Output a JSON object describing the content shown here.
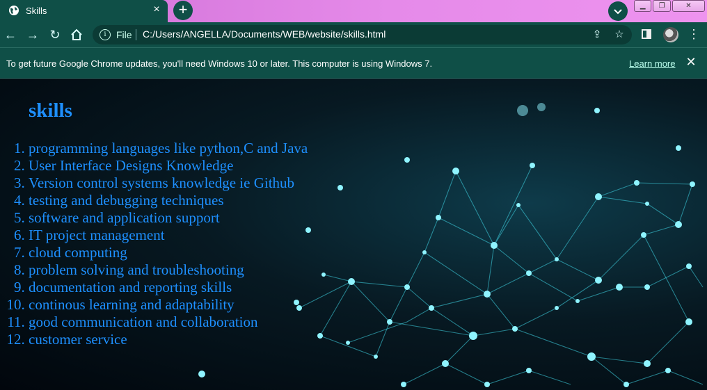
{
  "browser": {
    "tab_title": "Skills",
    "file_label": "File",
    "url": "C:/Users/ANGELLA/Documents/WEB/website/skills.html",
    "accent": "#0f4f47",
    "frame_color": "#e58ae9"
  },
  "infobar": {
    "message": "To get future Google Chrome updates, you'll need Windows 10 or later. This computer is using Windows 7.",
    "learn_more": "Learn more"
  },
  "page": {
    "heading": "skills",
    "text_color": "#1e90ff",
    "skills": [
      "programming languages like python,C and Java",
      "User Interface Designs Knowledge",
      "Version control systems knowledge ie Github",
      "testing and debugging techniques",
      "software and application support",
      "IT project management",
      "cloud computing",
      "problem solving and troubleshooting",
      "documentation and reporting skills",
      "continous learning and adaptability",
      "good communication and collaboration",
      "customer service"
    ]
  }
}
